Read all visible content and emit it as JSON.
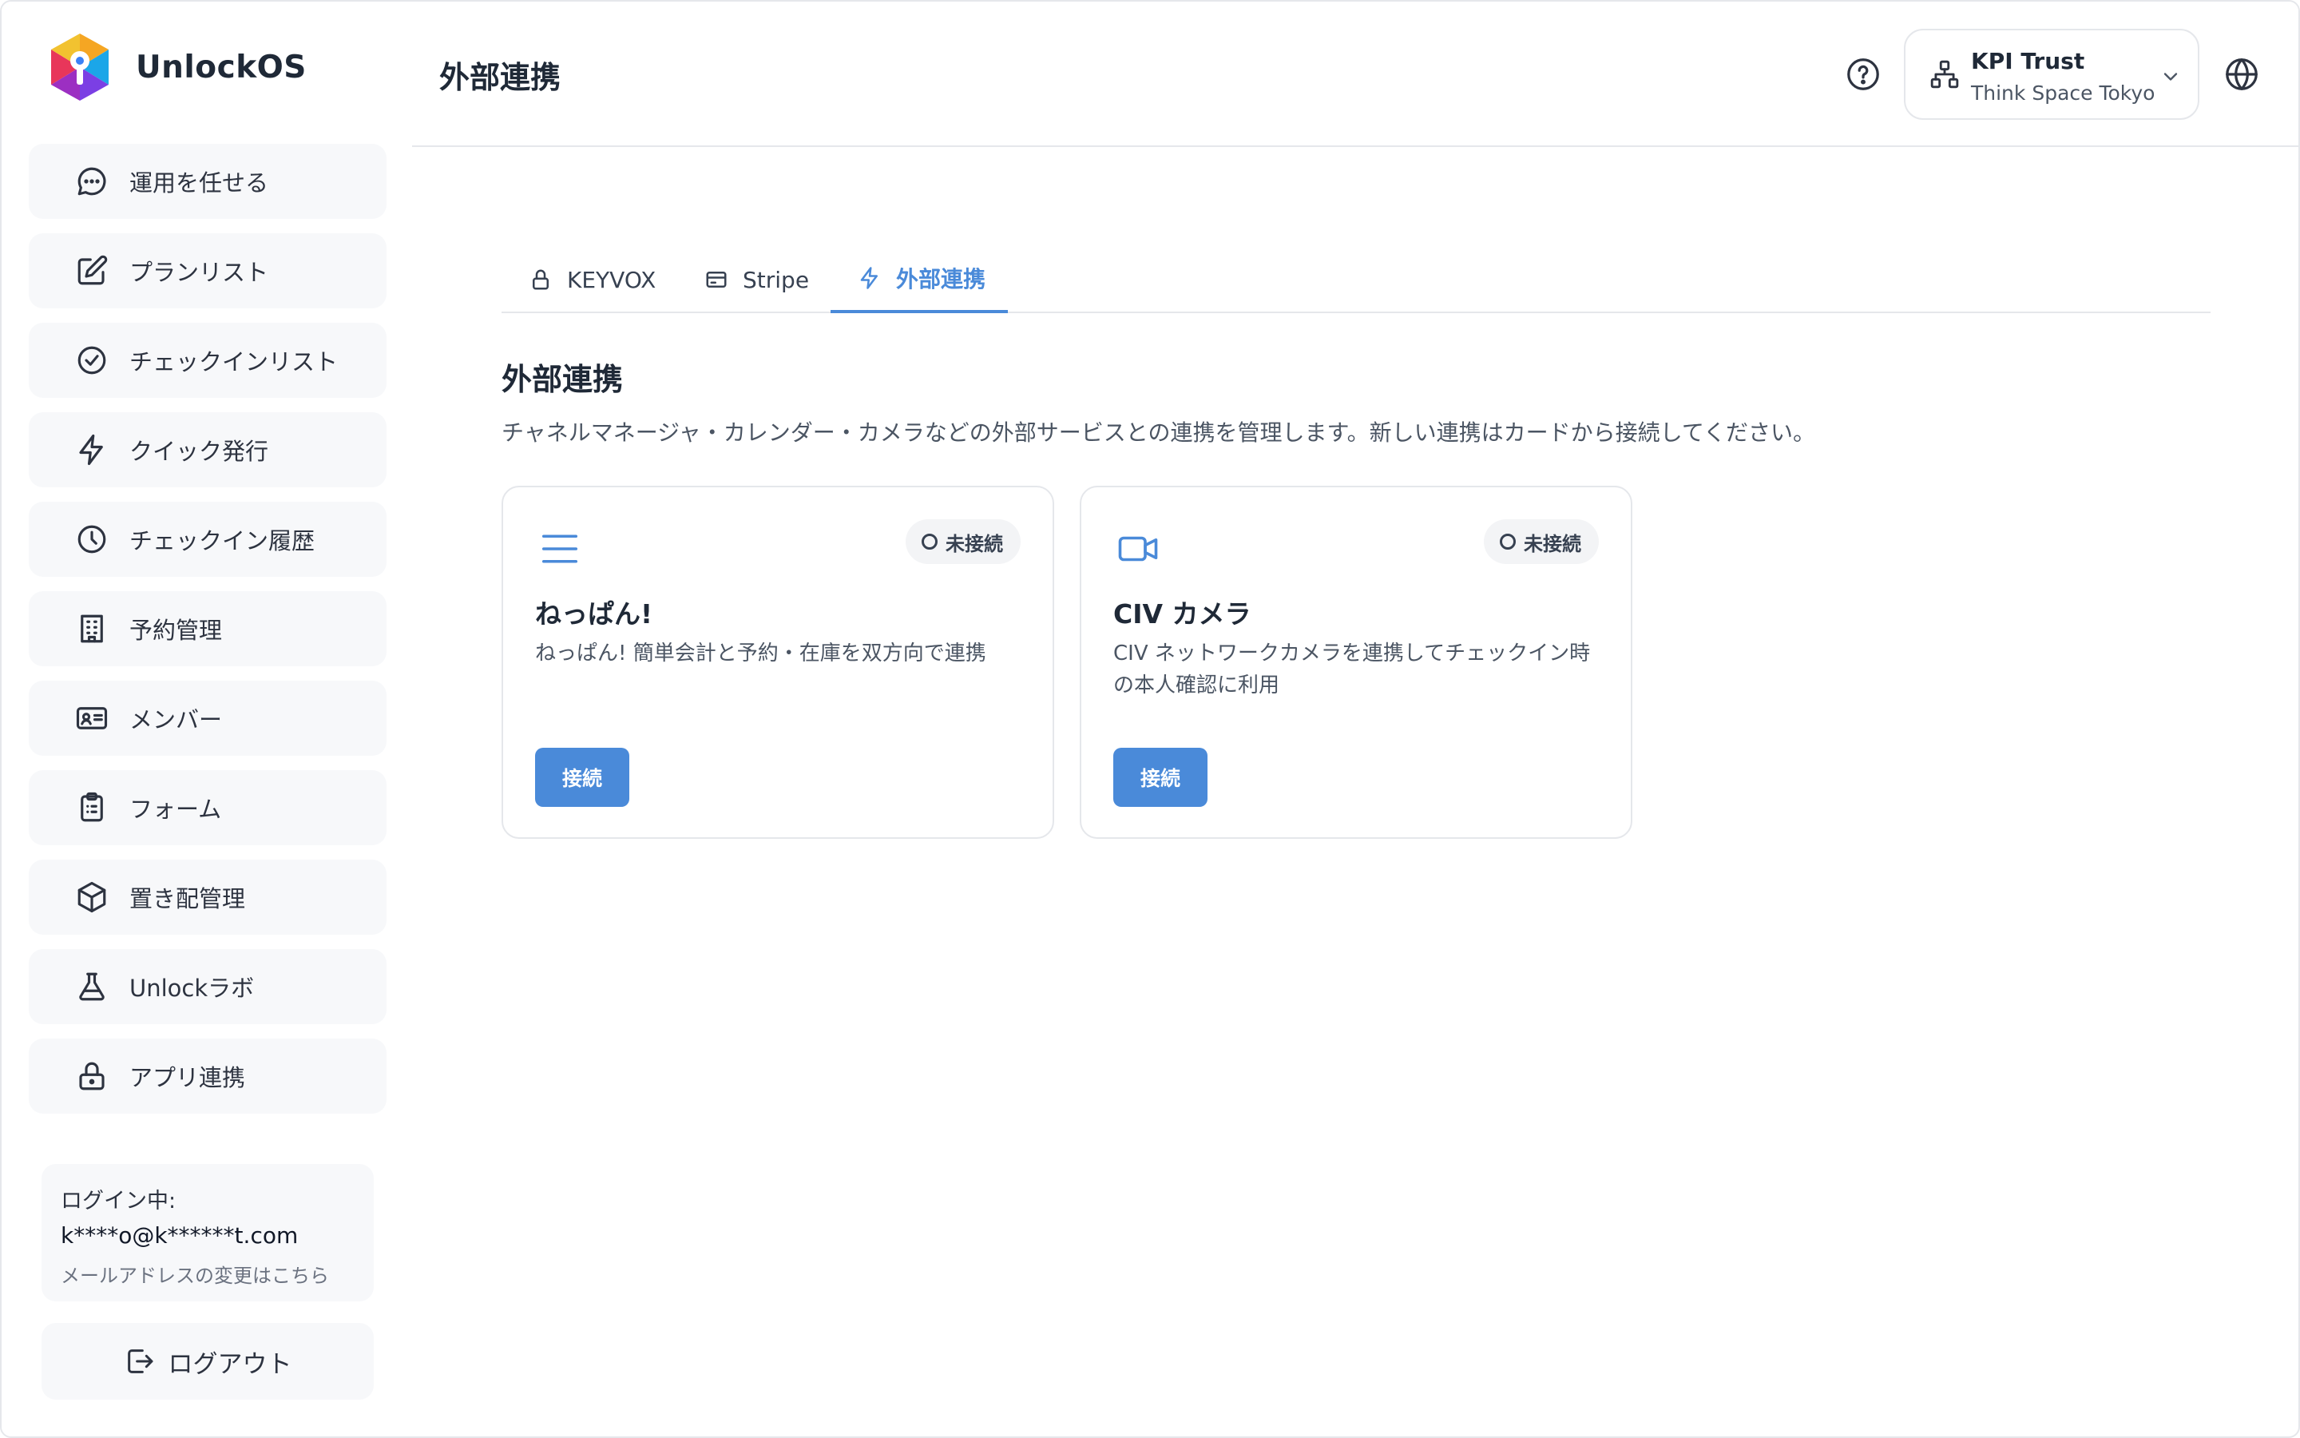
{
  "app": {
    "name": "UnlockOS"
  },
  "sidebar": {
    "items": [
      {
        "label": "運用を任せる",
        "icon": "chat-bubble-icon"
      },
      {
        "label": "プランリスト",
        "icon": "edit-icon"
      },
      {
        "label": "チェックインリスト",
        "icon": "check-circle-icon"
      },
      {
        "label": "クイック発行",
        "icon": "lightning-icon"
      },
      {
        "label": "チェックイン履歴",
        "icon": "clock-icon"
      },
      {
        "label": "予約管理",
        "icon": "building-icon"
      },
      {
        "label": "メンバー",
        "icon": "id-card-icon"
      },
      {
        "label": "フォーム",
        "icon": "clipboard-list-icon"
      },
      {
        "label": "置き配管理",
        "icon": "package-icon"
      },
      {
        "label": "Unlockラボ",
        "icon": "flask-icon"
      },
      {
        "label": "アプリ連携",
        "icon": "lock-icon"
      }
    ],
    "login": {
      "label": "ログイン中:",
      "email": "k****o@k******t.com",
      "change_link": "メールアドレスの変更はこちら"
    },
    "logout_label": "ログアウト"
  },
  "header": {
    "title": "外部連携",
    "org": {
      "name": "KPI Trust",
      "sub": "Think Space Tokyo"
    }
  },
  "tabs": [
    {
      "label": "KEYVOX",
      "icon": "lock-icon",
      "active": false
    },
    {
      "label": "Stripe",
      "icon": "credit-card-icon",
      "active": false
    },
    {
      "label": "外部連携",
      "icon": "lightning-icon",
      "active": true
    }
  ],
  "main": {
    "title": "外部連携",
    "description": "チャネルマネージャ・カレンダー・カメラなどの外部サービスとの連携を管理します。新しい連携はカードから接続してください。",
    "cards": [
      {
        "title": "ねっぱん!",
        "description": "ねっぱん! 簡単会計と予約・在庫を双方向で連携",
        "status": "未接続",
        "button": "接続",
        "icon": "menu-lines-icon"
      },
      {
        "title": "CIV カメラ",
        "description": "CIV ネットワークカメラを連携してチェックイン時の本人確認に利用",
        "status": "未接続",
        "button": "接続",
        "icon": "video-camera-icon"
      }
    ]
  },
  "colors": {
    "accent": "#4a8ad9",
    "nav_bg": "#f7f8fa",
    "border": "#e5e7eb"
  }
}
